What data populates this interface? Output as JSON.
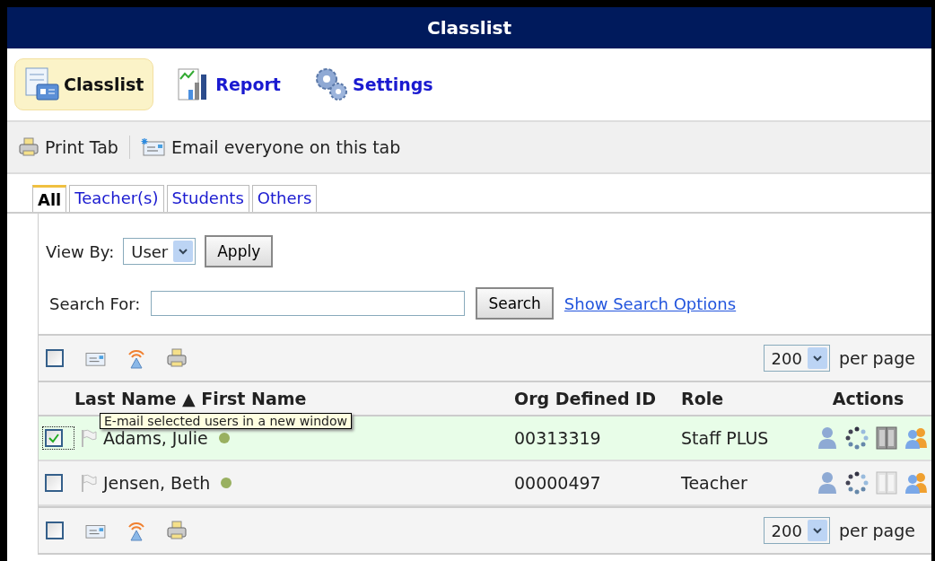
{
  "window": {
    "title": "Classlist"
  },
  "nav_tabs": [
    {
      "label": "Classlist",
      "selected": true,
      "kind": "classlist"
    },
    {
      "label": "Report",
      "selected": false,
      "kind": "report"
    },
    {
      "label": "Settings",
      "selected": false,
      "kind": "settings"
    }
  ],
  "action_bar": [
    {
      "label": "Print Tab",
      "kind": "print"
    },
    {
      "label": "Email everyone on this tab",
      "kind": "email"
    }
  ],
  "tabs": [
    {
      "label": "All",
      "selected": true
    },
    {
      "label": "Teacher(s)",
      "selected": false
    },
    {
      "label": "Students",
      "selected": false
    },
    {
      "label": "Others",
      "selected": false
    }
  ],
  "view_by": {
    "label": "View By:",
    "value": "User",
    "button": "Apply"
  },
  "search": {
    "label": "Search For:",
    "button": "Search",
    "link": "Show Search Options"
  },
  "pager_top": {
    "checked": false,
    "per_page_value": "200",
    "per_page_label": "per page"
  },
  "table": {
    "columns": [
      "Last Name ▲ First Name",
      "Org Defined ID",
      "Role",
      "Actions"
    ],
    "rows": [
      {
        "name": "Adams, Julie",
        "id": "00313319",
        "role": "Staff PLUS",
        "checked": true,
        "locker_enabled": true
      },
      {
        "name": "Jensen, Beth",
        "id": "00000497",
        "role": "Teacher",
        "checked": false,
        "locker_enabled": false
      }
    ]
  },
  "tooltip": "E-mail selected users in a new window",
  "pager_bottom": {
    "checked": false,
    "per_page_value": "200",
    "per_page_label": "per page"
  }
}
